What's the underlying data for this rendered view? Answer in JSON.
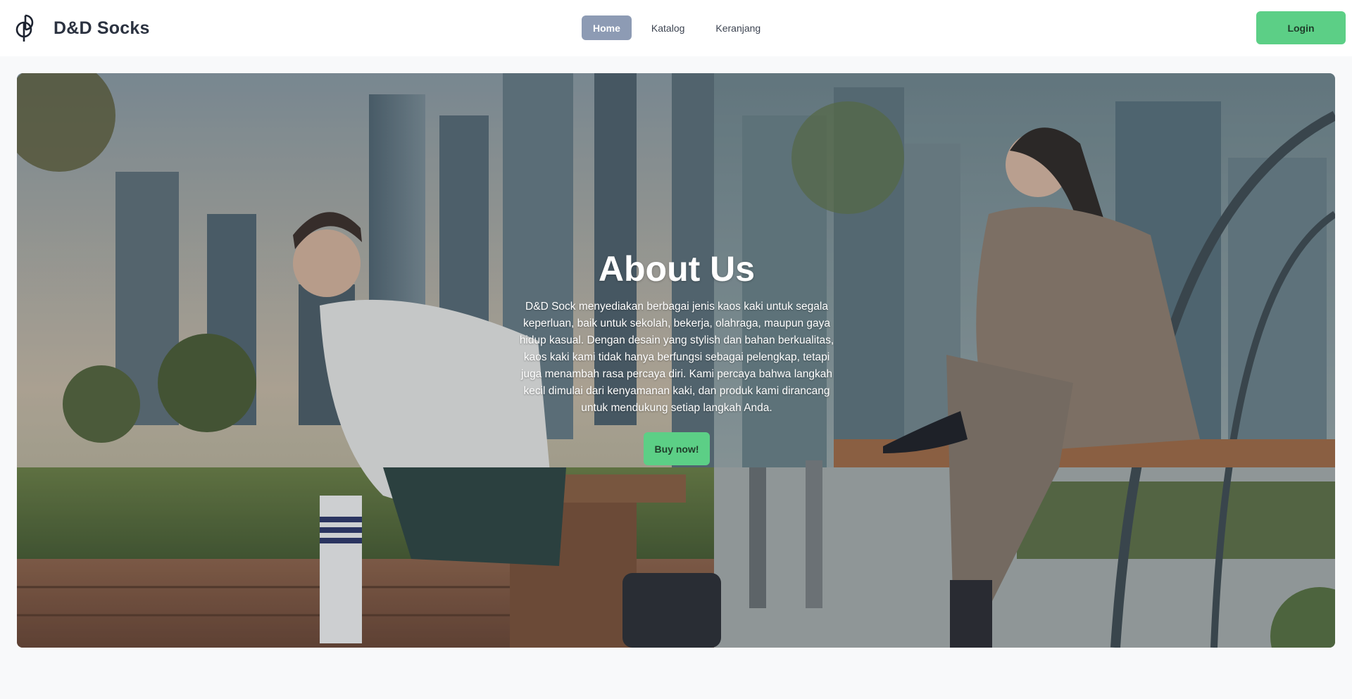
{
  "navbar": {
    "brand_name": "D&D Socks",
    "logo_icon": "dd-socks-logo-icon",
    "links": [
      {
        "label": "Home",
        "active": true
      },
      {
        "label": "Katalog",
        "active": false
      },
      {
        "label": "Keranjang",
        "active": false
      }
    ],
    "login_label": "Login"
  },
  "hero": {
    "title": "About Us",
    "description": "D&D Sock menyediakan berbagai jenis kaos kaki untuk segala keperluan, baik untuk sekolah, bekerja, olahraga, maupun gaya hidup kasual. Dengan desain yang stylish dan bahan berkualitas, kaos kaki kami tidak hanya berfungsi sebagai pelengkap, tetapi juga menambah rasa percaya diri. Kami percaya bahwa langkah kecil dimulai dari kenyamanan kaki, dan produk kami dirancang untuk mendukung setiap langkah Anda.",
    "cta_label": "Buy now!"
  },
  "colors": {
    "accent_green": "#5ccf86",
    "nav_active": "#8d9bb4",
    "page_background": "#f8f9fa"
  }
}
